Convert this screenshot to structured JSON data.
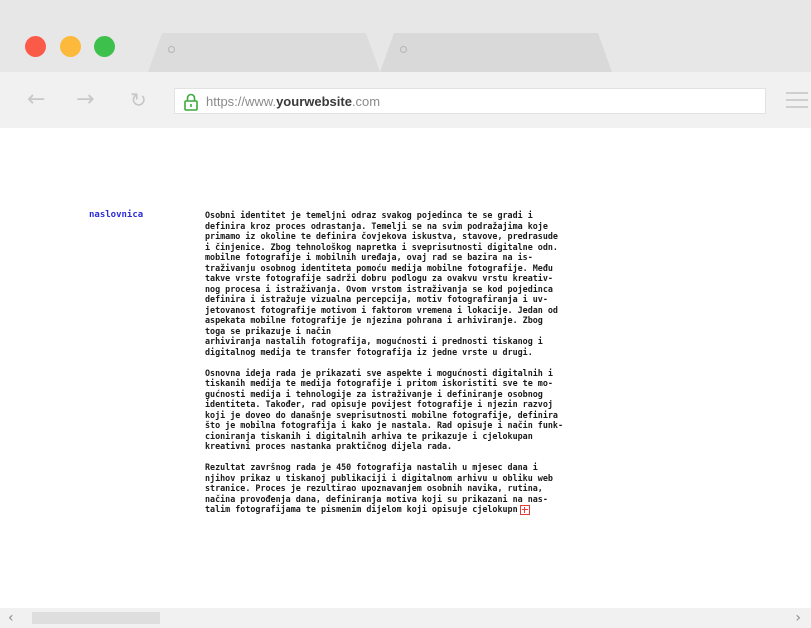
{
  "browser": {
    "url_prefix": "https://www.",
    "url_domain": "yourwebsite",
    "url_suffix": ".com",
    "icons": {
      "back": "←",
      "forward": "→",
      "reload": "↻",
      "scroll_left": "‹",
      "scroll_right": "›"
    },
    "colors": {
      "close": "#fb5a48",
      "minimize": "#fcb93b",
      "maximize": "#3ec04c",
      "lock": "#3ca93c"
    }
  },
  "page": {
    "nav_link": "naslovnica",
    "paragraphs": [
      "Osobni identitet je temeljni odraz svakog pojedinca te se gradi i\ndefinira kroz proces odrastanja. Temelji se na svim podražajima koje\nprimamo iz okoline te definira čovjekova iskustva, stavove, predrasude\ni činjenice. Zbog tehnološkog napretka i sveprisutnosti digitalne odn.\nmobilne fotografije i mobilnih uređaja, ovaj rad se bazira na is-\ntraživanju osobnog identiteta pomoću medija mobilne fotografije. Među\ntakve vrste fotografije sadrži dobru podlogu za ovakvu vrstu kreativ-\nnog procesa i istraživanja. Ovom vrstom istraživanja se kod pojedinca\ndefinira i istražuje vizualna percepcija, motiv fotografiranja i uv-\njetovanost fotografije motivom i faktorom vremena i lokacije. Jedan od\naspekata mobilne fotografije je njezina pohrana i arhiviranje. Zbog\ntoga se prikazuje i način\narhiviranja nastalih fotografija, mogućnosti i prednosti tiskanog i\ndigitalnog medija te transfer fotografija iz jedne vrste u drugi.",
      "Osnovna ideja rada je prikazati sve aspekte i mogućnosti digitalnih i\ntiskanih medija te medija fotografije i pritom iskoristiti sve te mo-\ngućnosti medija i tehnologije za istraživanje i definiranje osobnog\nidentiteta. Također, rad opisuje povijest fotografije i njezin razvoj\nkoji je doveo do današnje sveprisutnosti mobilne fotografije, definira\nšto je mobilna fotografija i kako je nastala. Rad opisuje i način funk-\ncioniranja tiskanih i digitalnih arhiva te prikazuje i cjelokupan\nkreativni proces nastanka praktičnog dijela rada.",
      "Rezultat završnog rada je 450 fotografija nastalih u mjesec dana i\nnjihov prikaz u tiskanoj publikaciji i digitalnom arhivu u obliku web\nstranice. Proces je rezultirao upoznavanjem osobnih navika, rutina,\nnačina provođenja dana, definiranja motiva koji su prikazani na nas-\ntalim fotografijama te pismenim dijelom koji opisuje cjelokupn"
    ],
    "more_icon": "plus-box-icon",
    "more_color": "#e53b3b"
  }
}
